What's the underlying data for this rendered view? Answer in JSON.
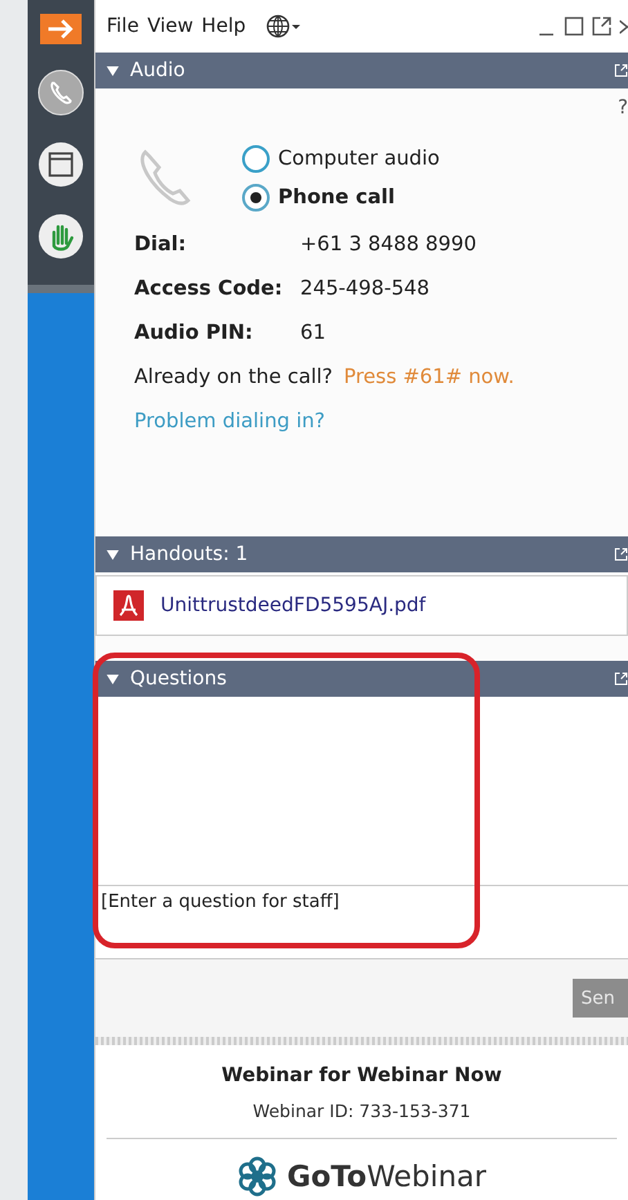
{
  "menu": [
    "File",
    "View",
    "Help"
  ],
  "audio": {
    "title": "Audio",
    "help": "?",
    "options": [
      {
        "label": "Computer audio",
        "selected": false
      },
      {
        "label": "Phone call",
        "selected": true
      }
    ],
    "details": [
      {
        "label": "Dial:",
        "value": "+61 3 8488 8990"
      },
      {
        "label": "Access Code:",
        "value": "245-498-548"
      },
      {
        "label": "Audio PIN:",
        "value": "61"
      }
    ],
    "already": "Already on the call?",
    "press": "Press #61# now.",
    "problem_link": "Problem dialing in?"
  },
  "handouts": {
    "title": "Handouts: 1",
    "files": [
      "UnittrustdeedFD5595AJ.pdf"
    ]
  },
  "questions": {
    "title": "Questions",
    "placeholder": "[Enter a question for staff]",
    "send": "Sen"
  },
  "footer": {
    "title": "Webinar for Webinar Now",
    "webinar_id": "Webinar ID: 733-153-371",
    "logo": "**GoTo**Webinar"
  }
}
